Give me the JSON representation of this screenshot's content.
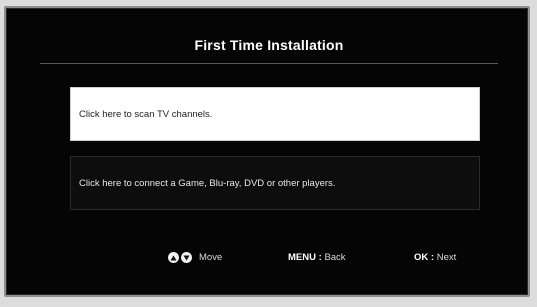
{
  "dialog": {
    "title": "First Time Installation"
  },
  "options": [
    {
      "label": "Click here to scan TV channels.",
      "selected": true
    },
    {
      "label": "Click here to connect a Game, Blu-ray, DVD or other players.",
      "selected": false
    }
  ],
  "help_bar": {
    "move_label": "Move",
    "back_key": "MENU",
    "back_sep": " : ",
    "back_action": "Back",
    "next_key": "OK",
    "next_sep": " : ",
    "next_action": "Next"
  },
  "icons": {
    "up": "up-arrow-icon",
    "down": "down-arrow-icon"
  },
  "colors": {
    "background": "#050505",
    "selected_option": "#ffffff",
    "text_light": "#ffffff"
  }
}
